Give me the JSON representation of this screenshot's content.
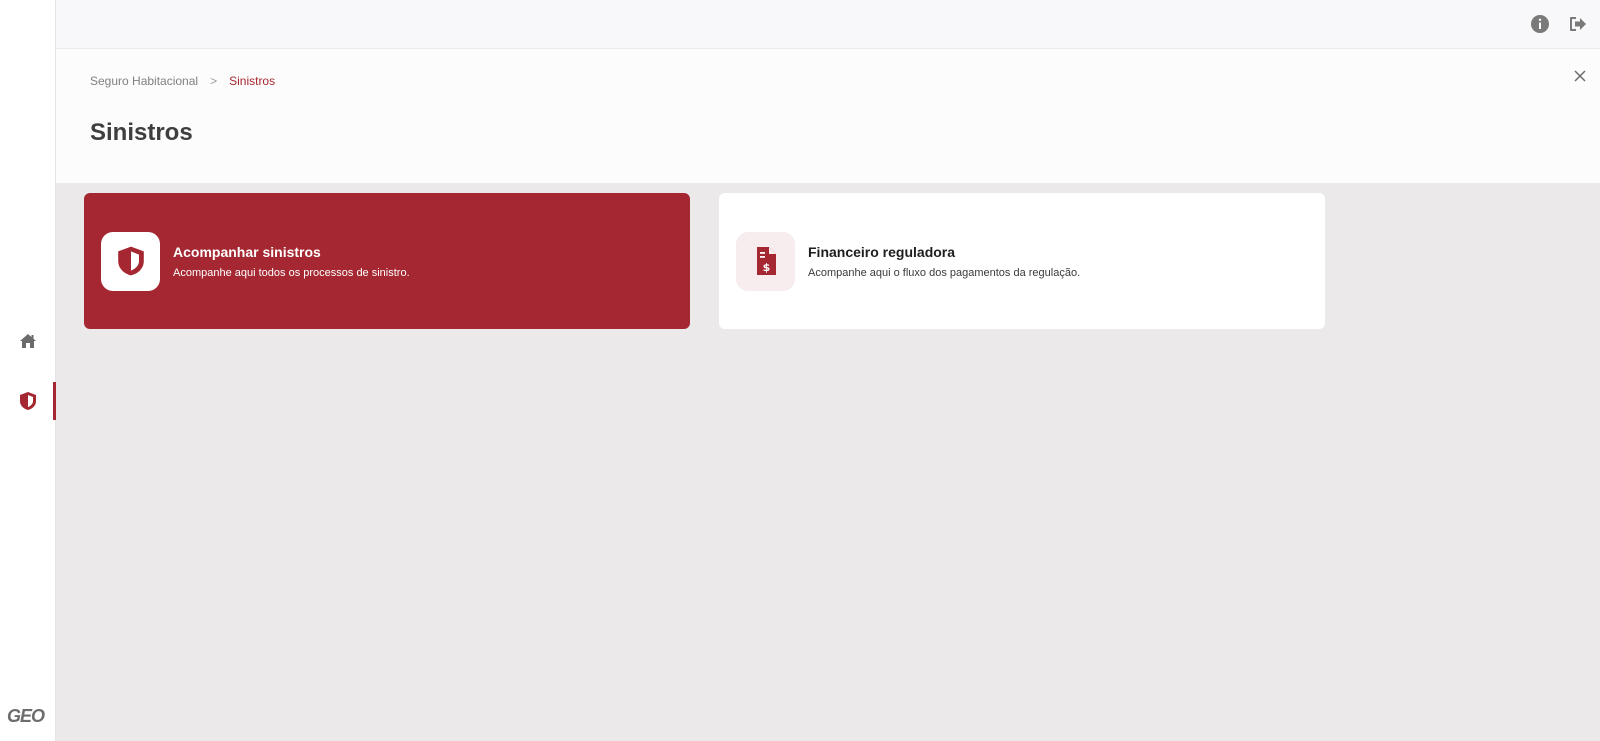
{
  "sidebar": {
    "items": [
      {
        "name": "home",
        "icon": "home-icon"
      },
      {
        "name": "claims",
        "icon": "shield-icon",
        "active": true
      }
    ],
    "logo": "GEO"
  },
  "topbar": {
    "icons": [
      "info-icon",
      "logout-icon"
    ]
  },
  "header": {
    "breadcrumb": [
      "Seguro Habitacional",
      "Sinistros"
    ],
    "title": "Sinistros",
    "close_icon": "close-icon"
  },
  "cards": [
    {
      "title": "Acompanhar sinistros",
      "description": "Acompanhe aqui todos os processos de sinistro.",
      "icon": "shield-icon"
    },
    {
      "title": "Financeiro reguladora",
      "description": "Acompanhe aqui o fluxo dos pagamentos da regulação.",
      "icon": "document-dollar-icon"
    }
  ],
  "colors": {
    "accent": "#a52731",
    "background": "#ebe9ea",
    "header_bg": "#fcfcfc",
    "topbar_bg": "#f8f8fa"
  }
}
